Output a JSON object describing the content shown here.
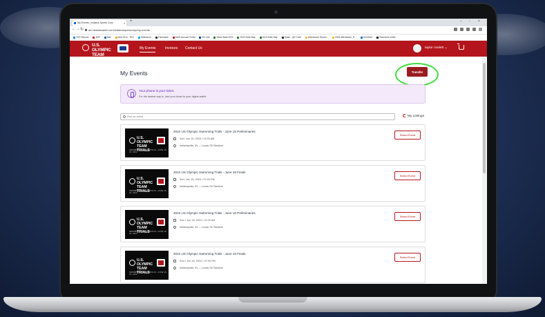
{
  "browser": {
    "tab_title": "My Events | Indiana Sports Corp",
    "new_tab": "+",
    "url": "am.ticketmaster.com/indianasportscorp/my-events",
    "bookmarks": [
      "TMT Reports",
      "ADP",
      "Mail",
      "New Tech - TEO",
      "Salesforce",
      "Formstack",
      "NAIS Account Portal",
      "ISC-AM",
      "Sales Stats 2023",
      "2023 Suite Map",
      "2023 Suite Map",
      "Dylan - QR Code",
      "Attendance Report...",
      "2023 Attendance_R...",
      "OneDrive",
      "Teamwork online"
    ]
  },
  "header": {
    "logo_text": "U.S. OLYMPIC TEAM TRIALS",
    "nav": [
      "My Events",
      "Invoices",
      "Contact Us"
    ],
    "user_name": "taylor rowlett"
  },
  "page": {
    "title": "My Events",
    "transfer_label": "Transfer",
    "banner_title": "Your phone is your ticket.",
    "banner_sub": "For the fastest way in, add your ticket to your digital wallet.",
    "search_placeholder": "Find an event",
    "listings_label": "My Listings"
  },
  "thumb": {
    "line1": "U.S. OLYMPIC",
    "line2": "TEAM TRIALS",
    "sub": "SWIMMING • INDIANAPOLIS • JUNE 15-23, 2024"
  },
  "events": [
    {
      "name": "2024 US Olympic Swimming Trials - June 15 Preliminaries",
      "date": "Sat • Jun 15, 2024 • 11:00 AM",
      "venue": "Indianapolis, IN — Lucas Oil Stadium",
      "button": "Select Event"
    },
    {
      "name": "2024 US Olympic Swimming Trials - June 15 Finals",
      "date": "Sat • Jun 15, 2024 • 07:00 PM",
      "venue": "Indianapolis, IN — Lucas Oil Stadium",
      "button": "Select Event"
    },
    {
      "name": "2024 US Olympic Swimming Trials - June 16 Preliminaries",
      "date": "Sun • Jun 16, 2024 • 11:00 AM",
      "venue": "Indianapolis, IN — Lucas Oil Stadium",
      "button": "Select Event"
    },
    {
      "name": "2024 US Olympic Swimming Trials - June 16 Finals",
      "date": "Sun • Jun 16, 2024 • 07:00 PM",
      "venue": "Indianapolis, IN — Lucas Oil Stadium",
      "button": "Select Event"
    }
  ],
  "colors": {
    "brand_red": "#b4141b",
    "highlight_green": "#3ddc3a",
    "banner_purple": "#f3e9fa"
  }
}
